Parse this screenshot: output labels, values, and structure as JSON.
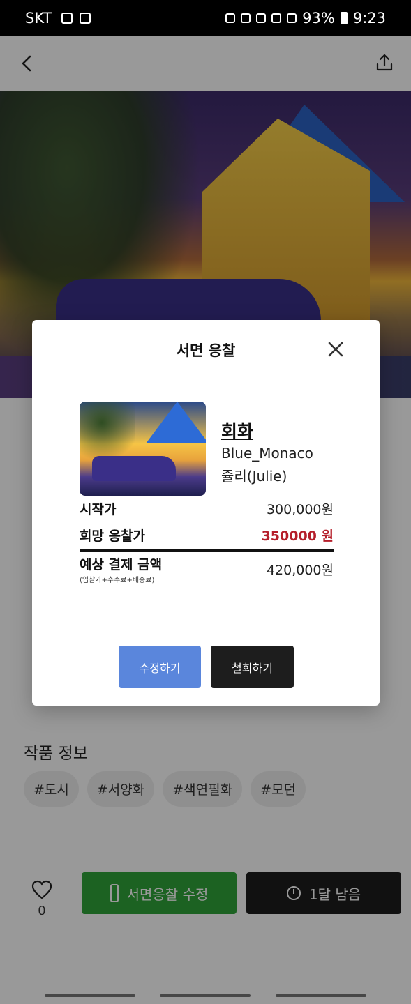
{
  "status_bar": {
    "carrier": "SKT",
    "battery": "93%",
    "time": "9:23"
  },
  "tags_section": {
    "title": "작품 정보",
    "tags": [
      "#도시",
      "#서양화",
      "#색연필화",
      "#모던"
    ]
  },
  "bottom_bar": {
    "like_count": "0",
    "edit_bid_label": "서면응찰 수정",
    "time_left_label": "1달 남음"
  },
  "modal": {
    "title": "서면 응찰",
    "artwork": {
      "category": "회화",
      "name": "Blue_Monaco",
      "artist": "쥴리(Julie)"
    },
    "start_price": {
      "label": "시작가",
      "value": "300,000원"
    },
    "desired_bid": {
      "label": "희망 응찰가",
      "value": "350000 원"
    },
    "expected_payment": {
      "label": "예상 결제 금액",
      "note": "(입찰가+수수료+배송료)",
      "value": "420,000원"
    },
    "buttons": {
      "modify": "수정하기",
      "withdraw": "철회하기"
    }
  },
  "colors": {
    "desired_bid": "#b51e2a",
    "modify_button": "#5a86dc",
    "edit_bid_button": "#2fa43a",
    "dark_button": "#1d1d1d"
  }
}
